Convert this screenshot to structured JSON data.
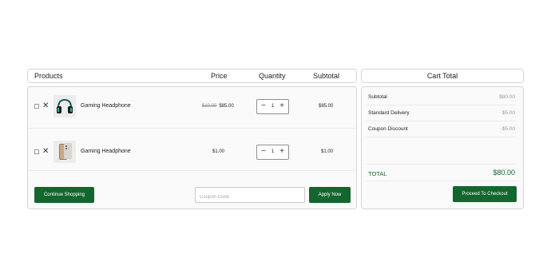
{
  "table_header": {
    "products": "Products",
    "price": "Price",
    "quantity": "Quantity",
    "subtotal": "Subtotal"
  },
  "cart_total_header": "Cart Total",
  "items": [
    {
      "name": "Gaming Headphone",
      "old_price": "$10.00",
      "price": "$85.00",
      "quantity": "1",
      "subtotal": "$85.00",
      "image_icon": "headphone-icon"
    },
    {
      "name": "Gaming Headphone",
      "old_price": "",
      "price": "$1.00",
      "quantity": "1",
      "subtotal": "$1.00",
      "image_icon": "phone-icon"
    }
  ],
  "actions": {
    "continue_label": "Continue Shopping",
    "coupon_placeholder": "Coupon Code",
    "apply_label": "Apply Now"
  },
  "totals": {
    "subtotal_label": "Subtotal",
    "subtotal_value": "$80.00",
    "delivery_label": "Standard Delivery",
    "delivery_value": "$5.00",
    "discount_label": "Coupon Discount",
    "discount_value": "-$5.00",
    "total_label": "TOTAL",
    "total_value": "$80.00",
    "checkout_label": "Proceed To Checkout"
  },
  "colors": {
    "accent": "#14662f",
    "border": "#d6d6d6",
    "muted_text": "#9a9a9a"
  }
}
